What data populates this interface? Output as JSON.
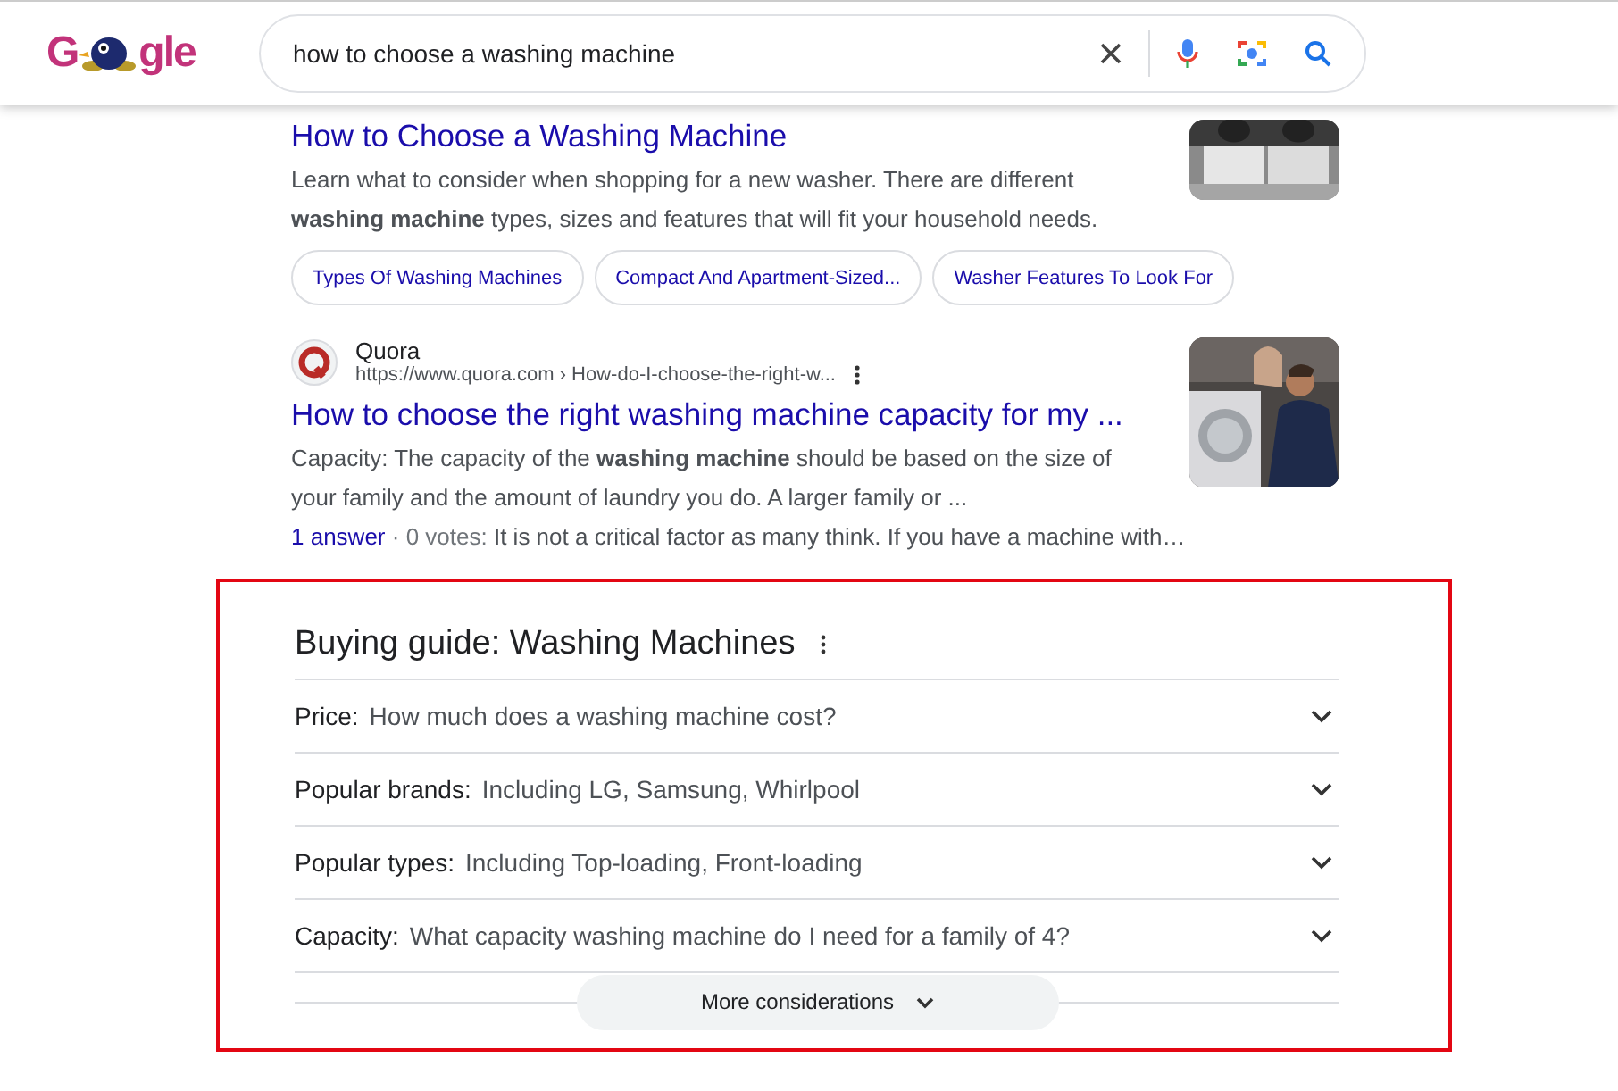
{
  "header": {
    "logo": {
      "left": "G",
      "right": "gle"
    },
    "search": {
      "value": "how to choose a washing machine"
    }
  },
  "results": [
    {
      "kind": "partial",
      "title": "How to Choose a Washing Machine",
      "snippet": "Learn what to consider when shopping for a new washer. There are different **washing machine** types, sizes and features that will fit your household needs.",
      "chips": [
        "Types Of Washing Machines",
        "Compact And Apartment-Sized...",
        "Washer Features To Look For"
      ]
    },
    {
      "kind": "full",
      "site": "Quora",
      "url": "https://www.quora.com › How-do-I-choose-the-right-w...",
      "title": "How to choose the right washing machine capacity for my ...",
      "snippet": "Capacity: The capacity of the **washing machine** should be based on the size of your family and the amount of laundry you do. A larger family or ...",
      "answer_link": "1 answer",
      "answer_meta": "· 0 votes:",
      "answer_text": "It is not a critical factor as many think. If you have a machine with…"
    }
  ],
  "guide": {
    "title": "Buying guide: Washing Machines",
    "highlighted": true,
    "items": [
      {
        "label": "Price:",
        "text": "How much does a washing machine cost?",
        "expanded": false
      },
      {
        "label": "Popular brands:",
        "text": "Including LG, Samsung, Whirlpool",
        "expanded": false
      },
      {
        "label": "Popular types:",
        "text": "Including Top-loading, Front-loading",
        "expanded": false
      },
      {
        "label": "Capacity:",
        "text": "What capacity washing machine do I need for a family of 4?",
        "expanded": false
      }
    ],
    "more": "More considerations"
  }
}
